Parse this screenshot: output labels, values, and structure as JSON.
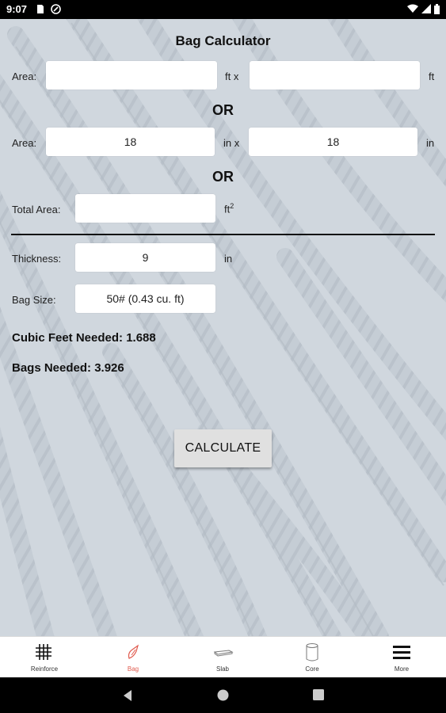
{
  "status_bar": {
    "time": "9:07"
  },
  "title": "Bag Calculator",
  "row_feet": {
    "label": "Area:",
    "value1": "",
    "unit1": "ft x",
    "value2": "",
    "unit2": "ft"
  },
  "or_1": "OR",
  "row_inches": {
    "label": "Area:",
    "value1": "18",
    "unit1": "in x",
    "value2": "18",
    "unit2": "in"
  },
  "or_2": "OR",
  "total_area": {
    "label": "Total Area:",
    "value": "",
    "unit": "ft",
    "unit_sup": "2"
  },
  "thickness": {
    "label": "Thickness:",
    "value": "9",
    "unit": "in"
  },
  "bag_size": {
    "label": "Bag Size:",
    "value": "50# (0.43 cu. ft)"
  },
  "results": {
    "cubic_feet": "Cubic Feet Needed: 1.688",
    "bags": "Bags Needed: 3.926"
  },
  "calculate_label": "CALCULATE",
  "bottom_nav": {
    "items": [
      {
        "label": "Reinforce",
        "icon": "grid-icon"
      },
      {
        "label": "Bag",
        "icon": "bag-icon",
        "active": true
      },
      {
        "label": "Slab",
        "icon": "slab-icon"
      },
      {
        "label": "Core",
        "icon": "cylinder-icon"
      },
      {
        "label": "More",
        "icon": "menu-icon"
      }
    ]
  },
  "colors": {
    "accent": "#e05a4e",
    "field_bg": "#ffffff",
    "button_bg": "#e0e0e0"
  }
}
